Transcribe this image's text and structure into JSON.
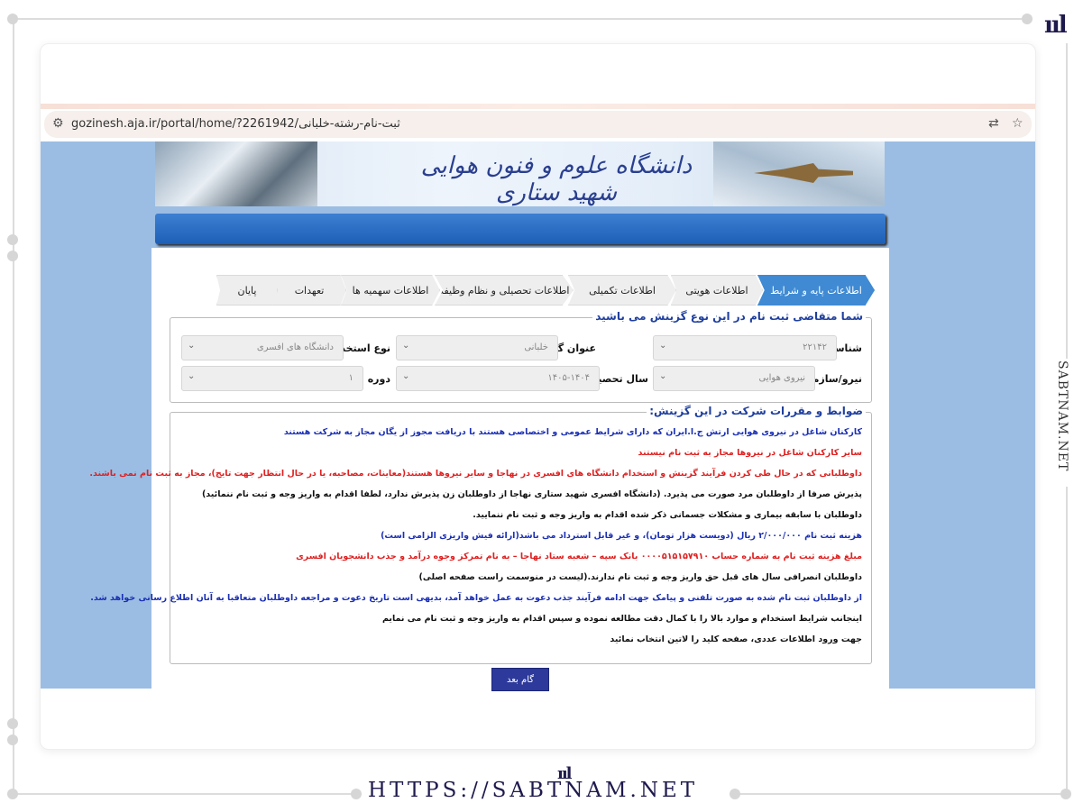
{
  "watermark": {
    "side_text": "SABTNAM.NET",
    "footer_url": "HTTPS://SABTNAM.NET",
    "logo_glyph": "ııl"
  },
  "browser": {
    "url": "gozinesh.aja.ir/portal/home/?2261942/ثبت-نام-رشته-خلبانی",
    "icons": [
      "site-settings-icon",
      "translate-icon",
      "bookmark-star-icon"
    ]
  },
  "banner": {
    "title": "دانشگاه علوم و فنون هوایی شهید ستاری"
  },
  "tabs": [
    {
      "label": "اطلاعات پایه و شرایط",
      "active": true
    },
    {
      "label": "اطلاعات هویتی",
      "active": false
    },
    {
      "label": "اطلاعات تکمیلی",
      "active": false
    },
    {
      "label": "اطلاعات تحصیلی و نظام وظیفه",
      "active": false
    },
    {
      "label": "اطلاعات سهمیه ها",
      "active": false
    },
    {
      "label": "تعهدات",
      "active": false
    },
    {
      "label": "پایان",
      "active": false
    }
  ],
  "application": {
    "legend": "شما متقاضی ثبت نام در این نوع گزینش می باشید",
    "fields": {
      "id": {
        "label": "شناسه",
        "value": "۲۲۱۴۲"
      },
      "title": {
        "label": "عنوان گزینش و استخدام",
        "value": "خلبانی"
      },
      "employment_type": {
        "label": "نوع استخدام",
        "value": "دانشگاه های افسری"
      },
      "force": {
        "label": "نیرو/سازمان",
        "value": "نیروی هوایی"
      },
      "academic_year": {
        "label": "سال تحصیلی",
        "value": "۱۴۰۵-۱۴۰۴"
      },
      "period": {
        "label": "دوره",
        "value": "۱"
      }
    }
  },
  "rules": {
    "legend": "ضوابط و مقررات شرکت در این گزینش:",
    "items": [
      {
        "text": "کارکنان شاغل در نیروی هوایی ارتش ج.ا.ایران که دارای شرایط عمومی و اختصاصی هستند با دریافت مجوز از یگان مجاز به شرکت هستند",
        "color": "#1a2fb5"
      },
      {
        "text": "سایر کارکنان شاغل در نیروها مجاز به ثبت نام نیستند",
        "color": "#e02020"
      },
      {
        "text": "داوطلبانی که در حال طی کردن فرآیند گزینش و استخدام دانشگاه های افسری در نهاجا و سایر نیروها هستند(معاینات، مصاحبه، یا در حال انتظار جهت تایج)، مجاز به ثبت نام نمی باشند.",
        "color": "#e02020"
      },
      {
        "text": "پذیرش صرفا از داوطلبان مرد صورت می پذیرد. (دانشگاه افسری شهید ستاری نهاجا از داوطلبان زن پذیرش ندارد، لطفا اقدام به واریز وجه و ثبت نام ننمائید)",
        "color": "#111111"
      },
      {
        "text": "داوطلبان با سابقه بیماری و مشکلات جسمانی ذکر شده اقدام به واریز وجه و ثبت نام ننمایید.",
        "color": "#111111"
      },
      {
        "text": "هزینه ثبت نام ۲/۰۰۰/۰۰۰ ریال (دویست هزار تومان)، و غیر قابل استرداد می باشد(ارائه فیش واریزی الزامی است)",
        "color": "#1a2fb5"
      },
      {
        "text": "مبلغ هزینه ثبت نام به شماره حساب ۰۰۰۰۵۱۵۱۵۷۹۱۰ بانک سپه – شعبه ستاد نهاجا – به نام تمرکز وجوه درآمد و جذب دانشجویان افسری",
        "color": "#e02020"
      },
      {
        "text": "داوطلبان انصرافی سال های قبل حق واریز وجه و ثبت نام ندارند.(لیست در منوسمت راست صفحه اصلی)",
        "color": "#111111"
      },
      {
        "text": "از داوطلبان ثبت نام شده به صورت تلفنی و پیامک جهت ادامه فرآیند جذب دعوت به عمل خواهد آمد، بدیهی است تاریخ دعوت و مراجعه داوطلبان متعاقبا به آنان اطلاع رسانی خواهد شد.",
        "color": "#1a2fb5"
      },
      {
        "text": "اینجانب شرایط استخدام و موارد بالا را با کمال دقت مطالعه نموده و سپس اقدام به واریز وجه و ثبت نام می نمایم",
        "color": "#111111"
      },
      {
        "text": "جهت ورود اطلاعات عددی، صفحه کلید را لاتین انتخاب نمائید",
        "color": "#111111"
      }
    ]
  },
  "next_button": {
    "label": "گام بعد"
  },
  "colors": {
    "page_bg": "#9bbde3",
    "active_tab": "#3f8ad3",
    "button": "#2d3a9b"
  }
}
